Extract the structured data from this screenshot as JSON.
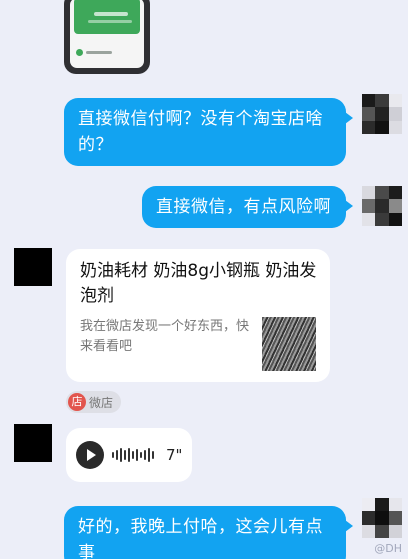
{
  "theme": {
    "background": "#eceef8",
    "outgoing_bubble": "#12a3f1",
    "incoming_bubble": "#ffffff",
    "shop_badge": "#e2554d"
  },
  "messages": [
    {
      "type": "image",
      "from": "self",
      "description_icon": "wechat-pay-screenshot"
    },
    {
      "type": "text",
      "from": "self",
      "text": "直接微信付啊？没有个淘宝店啥的？"
    },
    {
      "type": "text",
      "from": "self",
      "text": "直接微信，有点风险啊"
    },
    {
      "type": "link-card",
      "from": "other",
      "title": "奶油耗材 奶油8g小钢瓶 奶油发泡剂",
      "description": "我在微店发现一个好东西，快来看看吧",
      "source_label": "微店",
      "source_icon_text": "店"
    },
    {
      "type": "voice",
      "from": "other",
      "duration": "7\""
    },
    {
      "type": "text",
      "from": "self",
      "text": "好的，我晚上付哈，这会儿有点事"
    }
  ],
  "watermark": "@DH"
}
